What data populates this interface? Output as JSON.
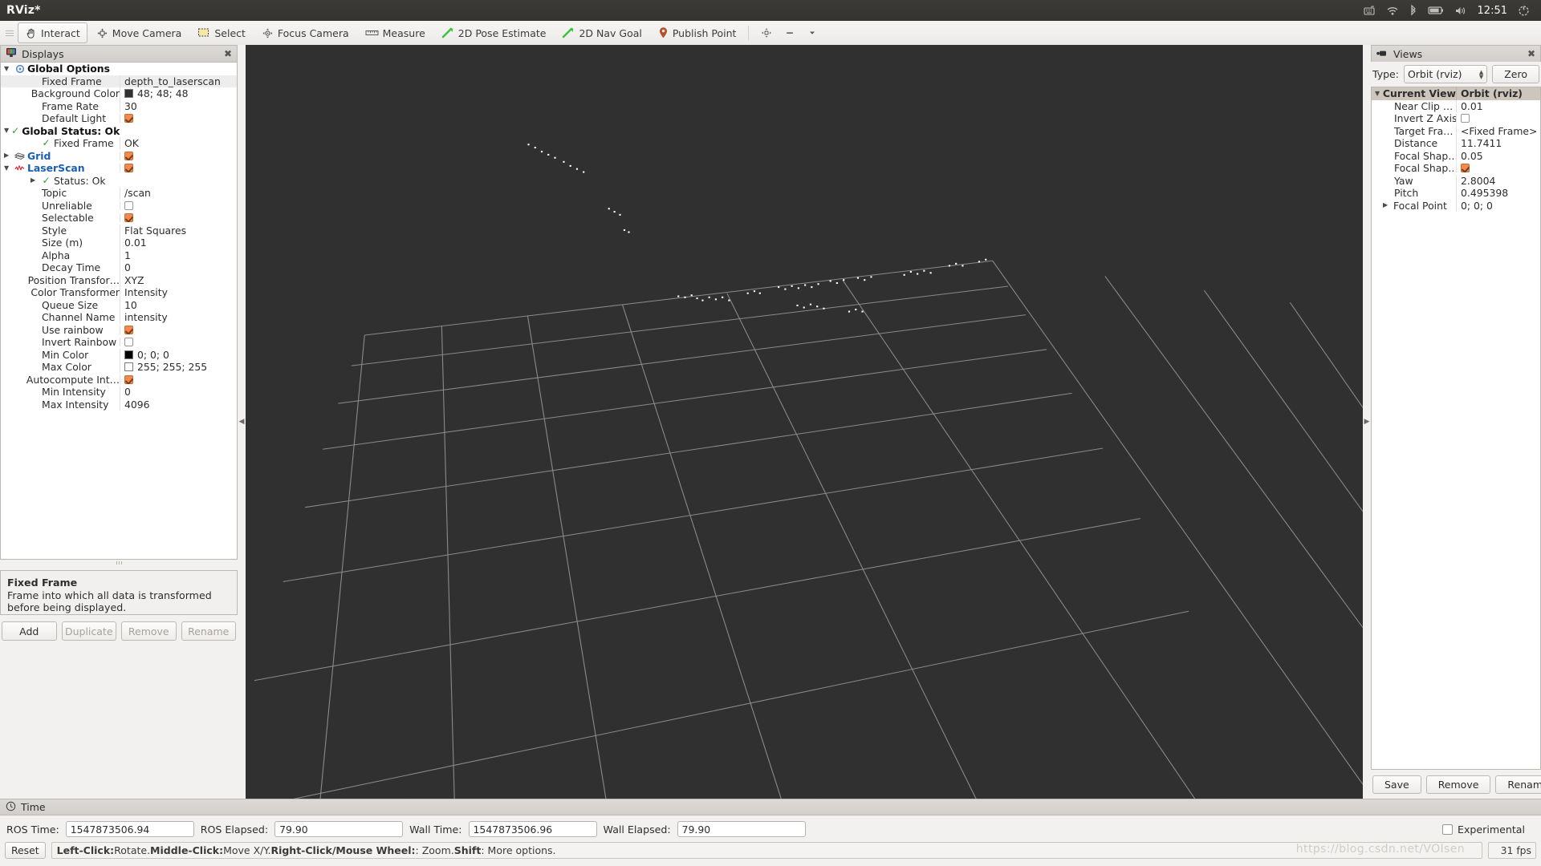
{
  "window": {
    "title": "RViz*"
  },
  "tray": {
    "icons": [
      "keyboard-icon",
      "wifi-icon",
      "bluetooth-icon",
      "battery-icon",
      "volume-icon"
    ],
    "clock": "12:51",
    "power_icon": "power-icon"
  },
  "toolbar": {
    "tools": [
      {
        "label": "Interact",
        "icon": "hand-cursor-icon",
        "active": true
      },
      {
        "label": "Move Camera",
        "icon": "move-camera-icon",
        "active": false
      },
      {
        "label": "Select",
        "icon": "select-rectangle-icon",
        "active": false
      },
      {
        "label": "Focus Camera",
        "icon": "focus-camera-icon",
        "active": false
      },
      {
        "label": "Measure",
        "icon": "ruler-icon",
        "active": false
      },
      {
        "label": "2D Pose Estimate",
        "icon": "green-arrow-icon",
        "active": false
      },
      {
        "label": "2D Nav Goal",
        "icon": "green-arrow-icon",
        "active": false
      },
      {
        "label": "Publish Point",
        "icon": "map-pin-icon",
        "active": false
      }
    ],
    "extra_icons": [
      "add-tool-icon",
      "minus-icon",
      "chevron-down-icon"
    ]
  },
  "displays": {
    "panel_title": "Displays",
    "panel_icon": "monitor-icon",
    "close_icon": "close-icon",
    "rows": [
      {
        "indent": 0,
        "arrow": "down",
        "icon": "gear-icon",
        "label": "Global Options",
        "bold": true,
        "link": false,
        "value_type": "none",
        "value": ""
      },
      {
        "indent": 1,
        "arrow": "blank",
        "icon": "",
        "label": "Fixed Frame",
        "bold": false,
        "link": false,
        "value_type": "text",
        "value": "depth_to_laserscan",
        "selected": true
      },
      {
        "indent": 1,
        "arrow": "blank",
        "icon": "",
        "label": "Background Color",
        "bold": false,
        "link": false,
        "value_type": "color",
        "value": "48; 48; 48",
        "color": "#303030"
      },
      {
        "indent": 1,
        "arrow": "blank",
        "icon": "",
        "label": "Frame Rate",
        "bold": false,
        "link": false,
        "value_type": "text",
        "value": "30"
      },
      {
        "indent": 1,
        "arrow": "blank",
        "icon": "",
        "label": "Default Light",
        "bold": false,
        "link": false,
        "value_type": "check",
        "value": "checked"
      },
      {
        "indent": 0,
        "arrow": "down",
        "icon": "check-ok-icon",
        "label": "Global Status: Ok",
        "bold": true,
        "link": false,
        "value_type": "none",
        "value": ""
      },
      {
        "indent": 2,
        "arrow": "blank",
        "icon": "check-ok-icon",
        "label": "Fixed Frame",
        "bold": false,
        "link": false,
        "value_type": "text",
        "value": "OK"
      },
      {
        "indent": 0,
        "arrow": "right",
        "icon": "grid-icon",
        "label": "Grid",
        "bold": true,
        "link": true,
        "value_type": "check",
        "value": "checked"
      },
      {
        "indent": 0,
        "arrow": "down",
        "icon": "laserscan-icon",
        "label": "LaserScan",
        "bold": true,
        "link": true,
        "value_type": "check",
        "value": "checked"
      },
      {
        "indent": 2,
        "arrow": "right",
        "icon": "check-ok-icon",
        "label": "Status: Ok",
        "bold": false,
        "link": false,
        "value_type": "none",
        "value": ""
      },
      {
        "indent": 1,
        "arrow": "blank",
        "icon": "",
        "label": "Topic",
        "bold": false,
        "link": false,
        "value_type": "text",
        "value": "/scan"
      },
      {
        "indent": 1,
        "arrow": "blank",
        "icon": "",
        "label": "Unreliable",
        "bold": false,
        "link": false,
        "value_type": "check",
        "value": "unchecked"
      },
      {
        "indent": 1,
        "arrow": "blank",
        "icon": "",
        "label": "Selectable",
        "bold": false,
        "link": false,
        "value_type": "check",
        "value": "checked"
      },
      {
        "indent": 1,
        "arrow": "blank",
        "icon": "",
        "label": "Style",
        "bold": false,
        "link": false,
        "value_type": "text",
        "value": "Flat Squares"
      },
      {
        "indent": 1,
        "arrow": "blank",
        "icon": "",
        "label": "Size (m)",
        "bold": false,
        "link": false,
        "value_type": "text",
        "value": "0.01"
      },
      {
        "indent": 1,
        "arrow": "blank",
        "icon": "",
        "label": "Alpha",
        "bold": false,
        "link": false,
        "value_type": "text",
        "value": "1"
      },
      {
        "indent": 1,
        "arrow": "blank",
        "icon": "",
        "label": "Decay Time",
        "bold": false,
        "link": false,
        "value_type": "text",
        "value": "0"
      },
      {
        "indent": 1,
        "arrow": "blank",
        "icon": "",
        "label": "Position Transfor…",
        "bold": false,
        "link": false,
        "value_type": "text",
        "value": "XYZ"
      },
      {
        "indent": 1,
        "arrow": "blank",
        "icon": "",
        "label": "Color Transformer",
        "bold": false,
        "link": false,
        "value_type": "text",
        "value": "Intensity"
      },
      {
        "indent": 1,
        "arrow": "blank",
        "icon": "",
        "label": "Queue Size",
        "bold": false,
        "link": false,
        "value_type": "text",
        "value": "10"
      },
      {
        "indent": 1,
        "arrow": "blank",
        "icon": "",
        "label": "Channel Name",
        "bold": false,
        "link": false,
        "value_type": "text",
        "value": "intensity"
      },
      {
        "indent": 1,
        "arrow": "blank",
        "icon": "",
        "label": "Use rainbow",
        "bold": false,
        "link": false,
        "value_type": "check",
        "value": "checked"
      },
      {
        "indent": 1,
        "arrow": "blank",
        "icon": "",
        "label": "Invert Rainbow",
        "bold": false,
        "link": false,
        "value_type": "check",
        "value": "unchecked"
      },
      {
        "indent": 1,
        "arrow": "blank",
        "icon": "",
        "label": "Min Color",
        "bold": false,
        "link": false,
        "value_type": "color",
        "value": "0; 0; 0",
        "color": "#000000"
      },
      {
        "indent": 1,
        "arrow": "blank",
        "icon": "",
        "label": "Max Color",
        "bold": false,
        "link": false,
        "value_type": "color",
        "value": "255; 255; 255",
        "color": "#ffffff"
      },
      {
        "indent": 1,
        "arrow": "blank",
        "icon": "",
        "label": "Autocompute Int…",
        "bold": false,
        "link": false,
        "value_type": "check",
        "value": "checked"
      },
      {
        "indent": 1,
        "arrow": "blank",
        "icon": "",
        "label": "Min Intensity",
        "bold": false,
        "link": false,
        "value_type": "text",
        "value": "0"
      },
      {
        "indent": 1,
        "arrow": "blank",
        "icon": "",
        "label": "Max Intensity",
        "bold": false,
        "link": false,
        "value_type": "text",
        "value": "4096"
      }
    ],
    "help": {
      "title": "Fixed Frame",
      "text": "Frame into which all data is transformed before being displayed."
    },
    "buttons": [
      {
        "label": "Add",
        "enabled": true
      },
      {
        "label": "Duplicate",
        "enabled": false
      },
      {
        "label": "Remove",
        "enabled": false
      },
      {
        "label": "Rename",
        "enabled": false
      }
    ]
  },
  "views": {
    "panel_title": "Views",
    "panel_icon": "camera-icon",
    "close_icon": "close-icon",
    "type_label": "Type:",
    "type_value": "Orbit (rviz)",
    "zero_button": "Zero",
    "header": {
      "label": "Current View",
      "value": "Orbit (rviz)"
    },
    "rows": [
      {
        "label": "Near Clip …",
        "value_type": "text",
        "value": "0.01"
      },
      {
        "label": "Invert Z Axis",
        "value_type": "check",
        "value": "unchecked"
      },
      {
        "label": "Target Fra…",
        "value_type": "text",
        "value": "<Fixed Frame>"
      },
      {
        "label": "Distance",
        "value_type": "text",
        "value": "11.7411"
      },
      {
        "label": "Focal Shap…",
        "value_type": "text",
        "value": "0.05"
      },
      {
        "label": "Focal Shap…",
        "value_type": "check",
        "value": "checked"
      },
      {
        "label": "Yaw",
        "value_type": "text",
        "value": "2.8004"
      },
      {
        "label": "Pitch",
        "value_type": "text",
        "value": "0.495398"
      },
      {
        "label": "Focal Point",
        "value_type": "text",
        "value": "0; 0; 0",
        "arrow": "right"
      }
    ],
    "buttons": [
      {
        "label": "Save"
      },
      {
        "label": "Remove"
      },
      {
        "label": "Rename"
      }
    ]
  },
  "time": {
    "panel_title": "Time",
    "panel_icon": "clock-icon",
    "fields": [
      {
        "label": "ROS Time:",
        "value": "1547873506.94"
      },
      {
        "label": "ROS Elapsed:",
        "value": "79.90"
      },
      {
        "label": "Wall Time:",
        "value": "1547873506.96"
      },
      {
        "label": "Wall Elapsed:",
        "value": "79.90"
      }
    ],
    "experimental_label": "Experimental",
    "experimental_checked": false
  },
  "status": {
    "reset_button": "Reset",
    "hint_segments": [
      {
        "text": "Left-Click:",
        "bold": true
      },
      {
        "text": " Rotate. ",
        "bold": false
      },
      {
        "text": "Middle-Click:",
        "bold": true
      },
      {
        "text": " Move X/Y. ",
        "bold": false
      },
      {
        "text": "Right-Click/Mouse Wheel:",
        "bold": true
      },
      {
        "text": ": Zoom. ",
        "bold": false
      },
      {
        "text": "Shift",
        "bold": true
      },
      {
        "text": ": More options.",
        "bold": false
      }
    ],
    "fps": "31 fps",
    "watermark": "https://blog.csdn.net/VOIsen"
  },
  "viewport": {
    "background_color": "#303030",
    "grid_color": "#9b9b9b",
    "point_color": "#ffffff",
    "splitter_left_icon": "collapse-left-arrow-icon",
    "splitter_right_icon": "collapse-right-arrow-icon"
  },
  "colors": {
    "accent_orange": "#f08a52",
    "link_blue": "#1a5fb4",
    "ok_green": "#2e9b2e",
    "panel_bg": "#f2f1f0",
    "titlebar_bg": "#3c3b37"
  }
}
